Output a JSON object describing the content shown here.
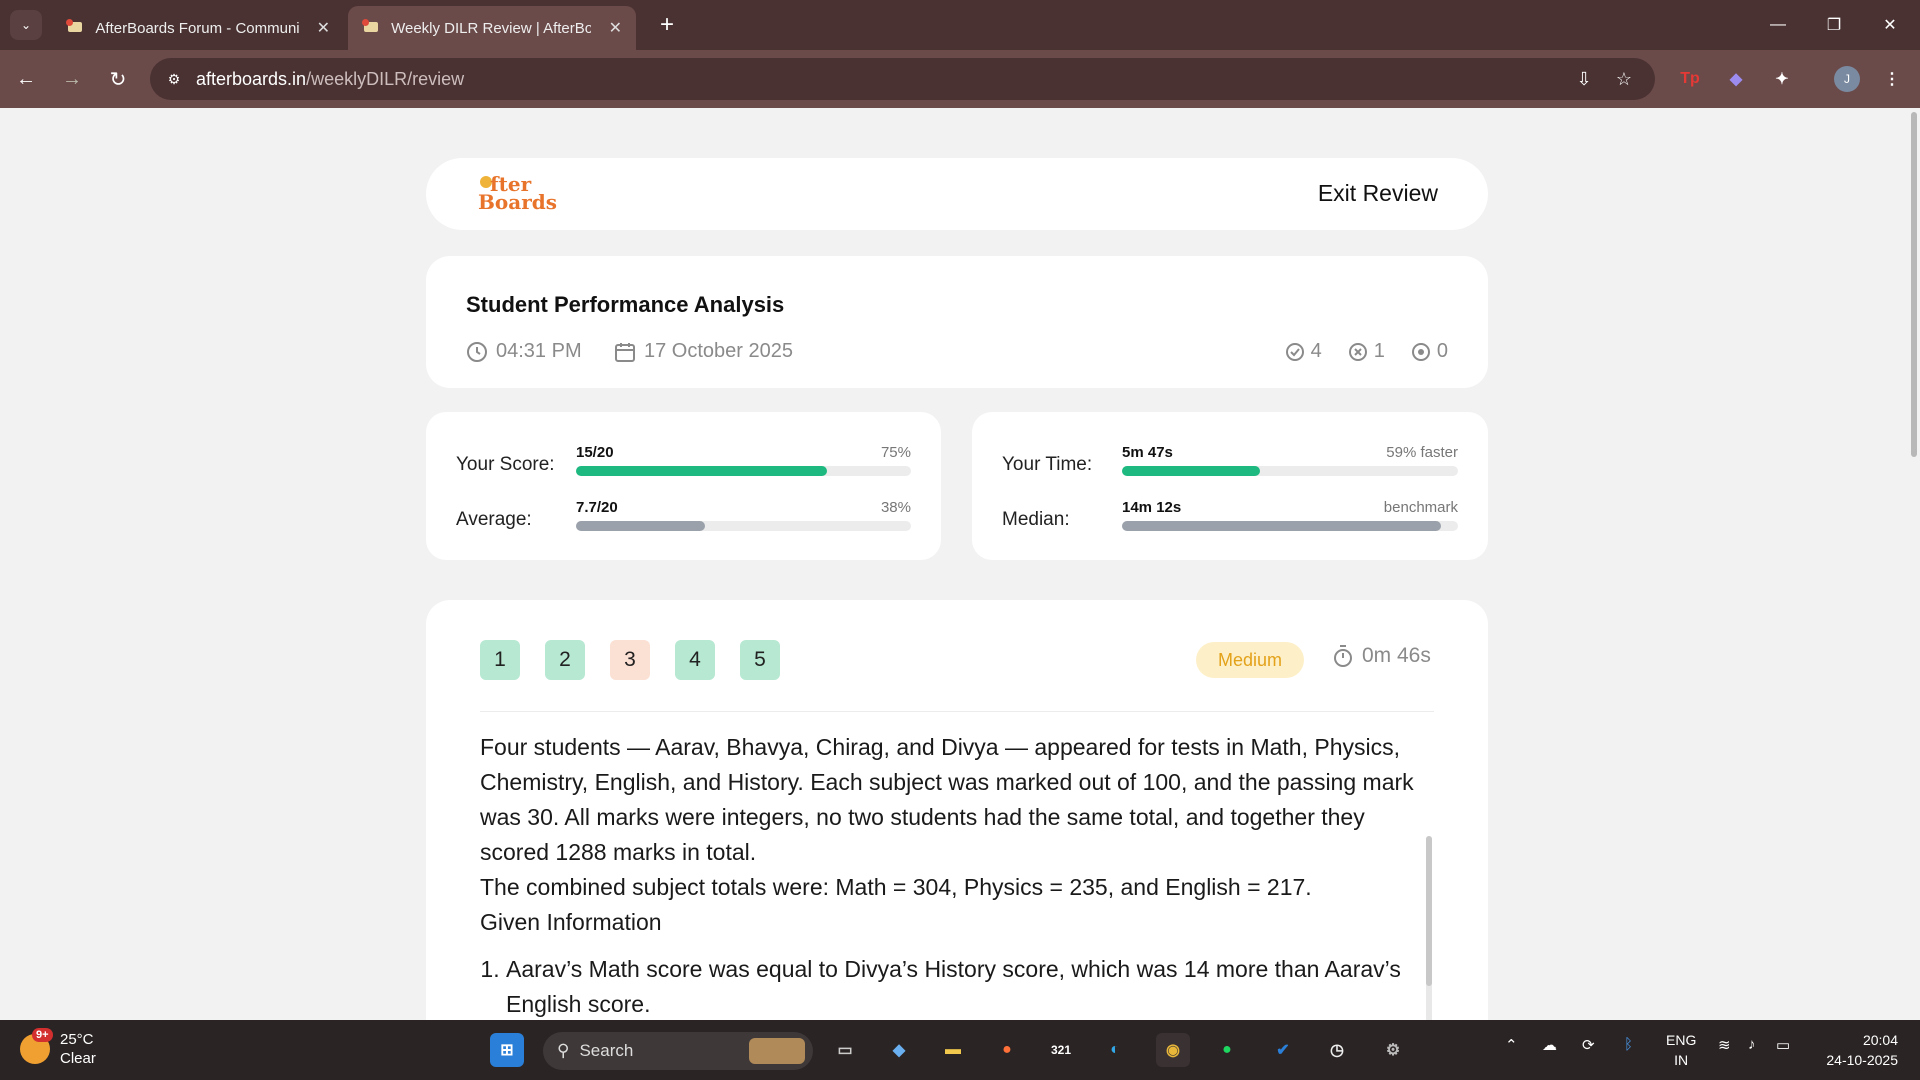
{
  "browser": {
    "tabs": [
      {
        "title": "AfterBoards Forum - Community",
        "active": false
      },
      {
        "title": "Weekly DILR Review | AfterBoards",
        "active": true
      }
    ],
    "url_domain": "afterboards.in",
    "url_path": "/weeklyDILR/review",
    "profile_initial": "J"
  },
  "header": {
    "logo_line1": "fter",
    "logo_line2": "Boards",
    "exit_label": "Exit Review"
  },
  "analysis": {
    "title": "Student Performance Analysis",
    "time": "04:31 PM",
    "date": "17 October 2025",
    "correct_count": "4",
    "wrong_count": "1",
    "skipped_count": "0"
  },
  "score": {
    "your_label": "Your Score:",
    "your_value": "15/20",
    "your_pct": "75%",
    "your_fill": 0.75,
    "avg_label": "Average:",
    "avg_value": "7.7/20",
    "avg_pct": "38%",
    "avg_fill": 0.385
  },
  "time": {
    "your_label": "Your Time:",
    "your_value": "5m 47s",
    "your_note": "59% faster",
    "your_fill": 0.41,
    "median_label": "Median:",
    "median_value": "14m 12s",
    "median_note": "benchmark",
    "median_fill": 0.95
  },
  "question": {
    "numbers": [
      "1",
      "2",
      "3",
      "4",
      "5"
    ],
    "status": [
      "correct",
      "correct",
      "wrong",
      "correct",
      "correct"
    ],
    "difficulty": "Medium",
    "time_spent": "0m 46s",
    "paragraph1": "Four students — Aarav, Bhavya, Chirag, and Divya — appeared for tests in Math, Physics, Chemistry, English, and History. Each subject was marked out of 100, and the passing mark was 30. All marks were integers, no two students had the same total, and together they scored 1288 marks in total.",
    "paragraph2": "The combined subject totals were: Math = 304, Physics = 235, and English = 217.",
    "given_heading": "Given Information",
    "given_items": [
      "Aarav’s Math score was equal to Divya’s History score, which was 14 more than Aarav’s English score."
    ]
  },
  "taskbar": {
    "temp": "25°C",
    "condition": "Clear",
    "badge": "9+",
    "search_placeholder": "Search",
    "calendar_day": "321",
    "lang1": "ENG",
    "lang2": "IN",
    "time": "20:04",
    "date": "24-10-2025"
  },
  "colors": {
    "green": "#1db980",
    "gray_bar": "#9aa1ab",
    "accent_orange": "#e8732a",
    "medium_badge_bg": "#fdf0c8",
    "medium_badge_text": "#e3a21a"
  }
}
